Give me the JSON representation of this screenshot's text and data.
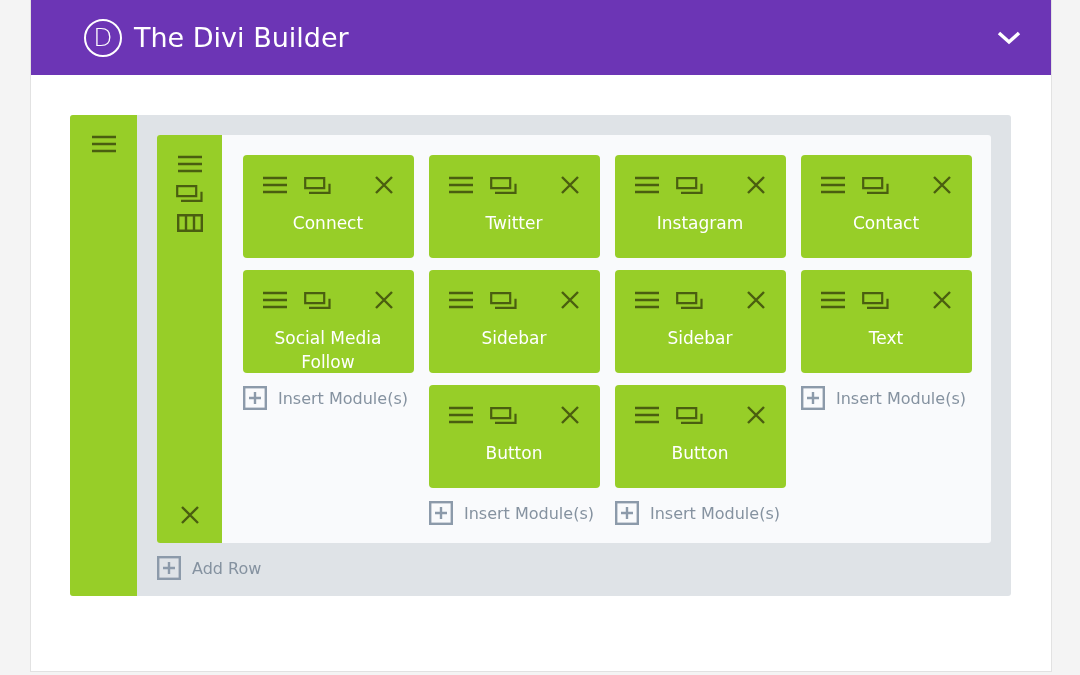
{
  "header": {
    "logo_letter": "D",
    "title": "The Divi Builder"
  },
  "row": {
    "columns": [
      {
        "modules": [
          "Connect",
          "Social Media\nFollow"
        ],
        "insert_label": "Insert Module(s)"
      },
      {
        "modules": [
          "Twitter",
          "Sidebar",
          "Button"
        ],
        "insert_label": "Insert Module(s)"
      },
      {
        "modules": [
          "Instagram",
          "Sidebar",
          "Button"
        ],
        "insert_label": "Insert Module(s)"
      },
      {
        "modules": [
          "Contact",
          "Text"
        ],
        "insert_label": "Insert Module(s)"
      }
    ]
  },
  "add_row_label": "Add Row"
}
